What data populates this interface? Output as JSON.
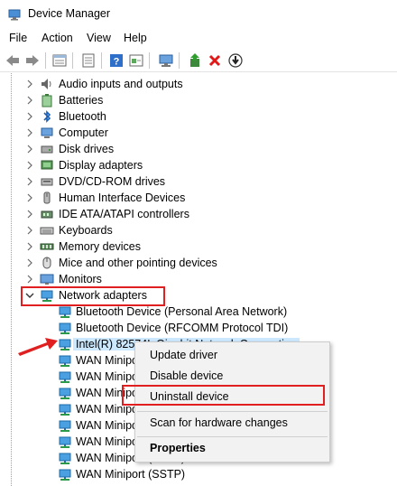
{
  "window": {
    "title": "Device Manager"
  },
  "menu": {
    "file": "File",
    "action": "Action",
    "view": "View",
    "help": "Help"
  },
  "toolbar": {
    "buttons": [
      "back-icon",
      "forward-icon",
      "device-tree-icon",
      "properties-icon",
      "help-icon",
      "show-hidden-icon",
      "scan-hardware-icon",
      "update-driver-icon",
      "uninstall-icon",
      "disable-icon"
    ]
  },
  "tree": {
    "categories": [
      {
        "label": "Audio inputs and outputs",
        "icon": "speaker-icon"
      },
      {
        "label": "Batteries",
        "icon": "battery-icon"
      },
      {
        "label": "Bluetooth",
        "icon": "bluetooth-icon"
      },
      {
        "label": "Computer",
        "icon": "computer-icon"
      },
      {
        "label": "Disk drives",
        "icon": "disk-icon"
      },
      {
        "label": "Display adapters",
        "icon": "display-icon"
      },
      {
        "label": "DVD/CD-ROM drives",
        "icon": "dvd-icon"
      },
      {
        "label": "Human Interface Devices",
        "icon": "hid-icon"
      },
      {
        "label": "IDE ATA/ATAPI controllers",
        "icon": "ide-icon"
      },
      {
        "label": "Keyboards",
        "icon": "keyboard-icon"
      },
      {
        "label": "Memory devices",
        "icon": "memory-icon"
      },
      {
        "label": "Mice and other pointing devices",
        "icon": "mouse-icon"
      },
      {
        "label": "Monitors",
        "icon": "monitor-icon"
      },
      {
        "label": "Network adapters",
        "icon": "network-icon"
      }
    ],
    "network_children": [
      "Bluetooth Device (Personal Area Network)",
      "Bluetooth Device (RFCOMM Protocol TDI)",
      "Intel(R) 82574L Gigabit Network Connection",
      "WAN Miniport (IKEv2)",
      "WAN Miniport (IP)",
      "WAN Miniport (IPv6)",
      "WAN Miniport (L2TP)",
      "WAN Miniport (Network Monitor)",
      "WAN Miniport (PPPOE)",
      "WAN Miniport (PPTP)",
      "WAN Miniport (SSTP)"
    ]
  },
  "context_menu": {
    "update_driver": "Update driver",
    "disable_device": "Disable device",
    "uninstall_device": "Uninstall device",
    "scan": "Scan for hardware changes",
    "properties": "Properties"
  },
  "colors": {
    "highlight": "#e02020",
    "selection": "#cce8ff",
    "accent": "#1e7fd8"
  }
}
